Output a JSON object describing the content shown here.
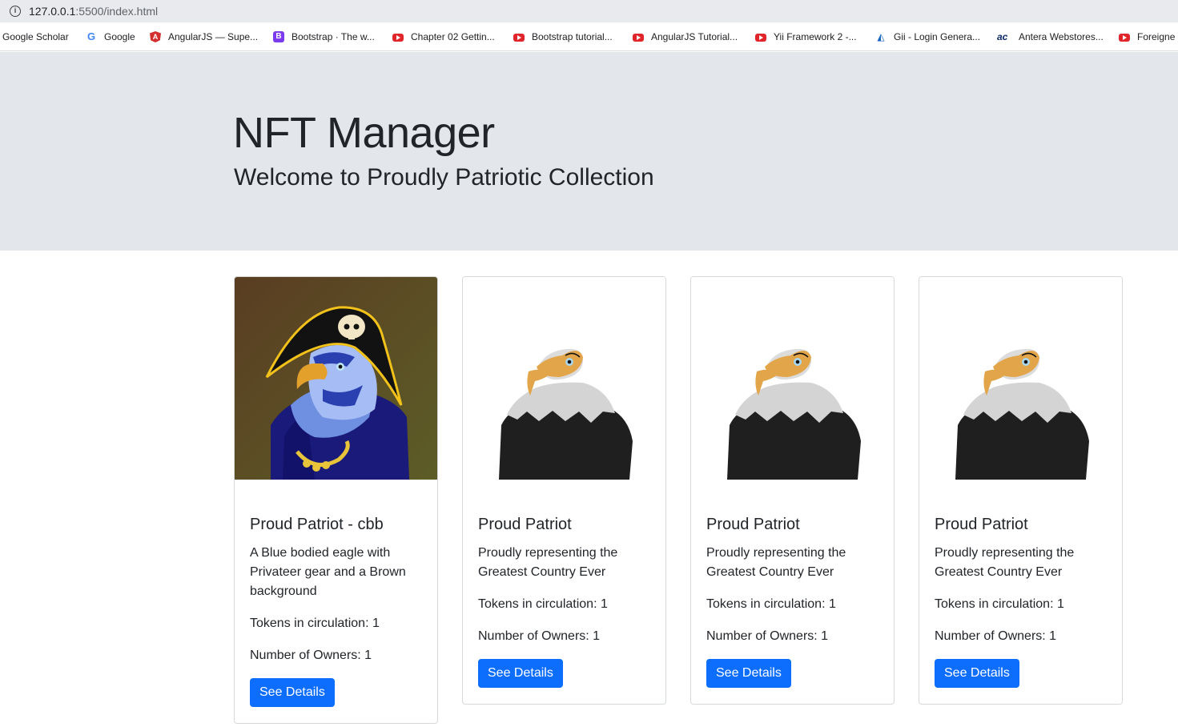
{
  "browser": {
    "url_host": "127.0.0.1",
    "url_rest": ":5500/index.html",
    "info_icon": "info-icon",
    "bookmarks": [
      {
        "label": "Google Scholar",
        "icon": "none"
      },
      {
        "label": "Google",
        "icon": "google-icon"
      },
      {
        "label": "AngularJS — Supe...",
        "icon": "angular-icon"
      },
      {
        "label": "Bootstrap · The w...",
        "icon": "bootstrap-icon"
      },
      {
        "label": "Chapter 02 Gettin...",
        "icon": "youtube-icon"
      },
      {
        "label": "Bootstrap tutorial...",
        "icon": "youtube-icon"
      },
      {
        "label": "AngularJS Tutorial...",
        "icon": "youtube-icon"
      },
      {
        "label": "Yii Framework 2 -...",
        "icon": "youtube-icon"
      },
      {
        "label": "Gii - Login Genera...",
        "icon": "gii-icon"
      },
      {
        "label": "Antera Webstores...",
        "icon": "antera-icon"
      },
      {
        "label": "Foreigne",
        "icon": "youtube-icon"
      }
    ]
  },
  "header": {
    "title": "NFT Manager",
    "subtitle": "Welcome to Proudly Patriotic Collection"
  },
  "cards": [
    {
      "image": "pirate-eagle-image",
      "title": "Proud Patriot - cbb",
      "description": "A Blue bodied eagle with Privateer gear and a Brown background",
      "tokens": "Tokens in circulation: 1",
      "owners": "Number of Owners: 1",
      "button": "See Details"
    },
    {
      "image": "eagle-image",
      "title": "Proud Patriot",
      "description": "Proudly representing the Greatest Country Ever",
      "tokens": "Tokens in circulation: 1",
      "owners": "Number of Owners: 1",
      "button": "See Details"
    },
    {
      "image": "eagle-image",
      "title": "Proud Patriot",
      "description": "Proudly representing the Greatest Country Ever",
      "tokens": "Tokens in circulation: 1",
      "owners": "Number of Owners: 1",
      "button": "See Details"
    },
    {
      "image": "eagle-image",
      "title": "Proud Patriot",
      "description": "Proudly representing the Greatest Country Ever",
      "tokens": "Tokens in circulation: 1",
      "owners": "Number of Owners: 1",
      "button": "See Details"
    }
  ],
  "colors": {
    "jumbotron_bg": "#e3e6ea",
    "button_primary": "#0d6efd",
    "card_border": "#d6d9dc"
  }
}
